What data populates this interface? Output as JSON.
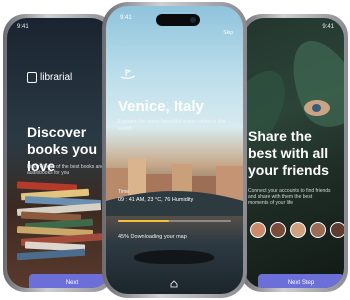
{
  "left_screen": {
    "status_time": "9:41",
    "logo_text": "librarial",
    "headline": "Discover books you love",
    "subtext": "Find millions of the best books and audiobooks for you",
    "button_label": "Next",
    "book_colors": [
      "#b53a2a",
      "#e2c47e",
      "#6a8fb0",
      "#d7d0c4",
      "#8b5a3c",
      "#3e6a4a",
      "#c9a86a",
      "#a24b3b",
      "#dcd6cc",
      "#4b6c8c"
    ]
  },
  "center_screen": {
    "status_time": "9:41",
    "skip_label": "Skip",
    "title": "Venice, Italy",
    "subtitle": "Explore the most beautiful water cities in the world",
    "weather_label": "Time",
    "weather_value": "09 : 41 AM, 23 °C, 76 Humidity",
    "progress_percent": 45,
    "progress_text": "45% Downloading your map",
    "accent_color": "#f0c23a"
  },
  "right_screen": {
    "status_time": "9:41",
    "headline": "Share the best with all your friends",
    "subtext": "Connect your accounts to find friends and share with them the best moments of your life",
    "button_label": "Next Step",
    "avatar_colors": [
      "#c98b6b",
      "#7a4a3a",
      "#d1a07e",
      "#9c6b55",
      "#5c3b30"
    ]
  }
}
